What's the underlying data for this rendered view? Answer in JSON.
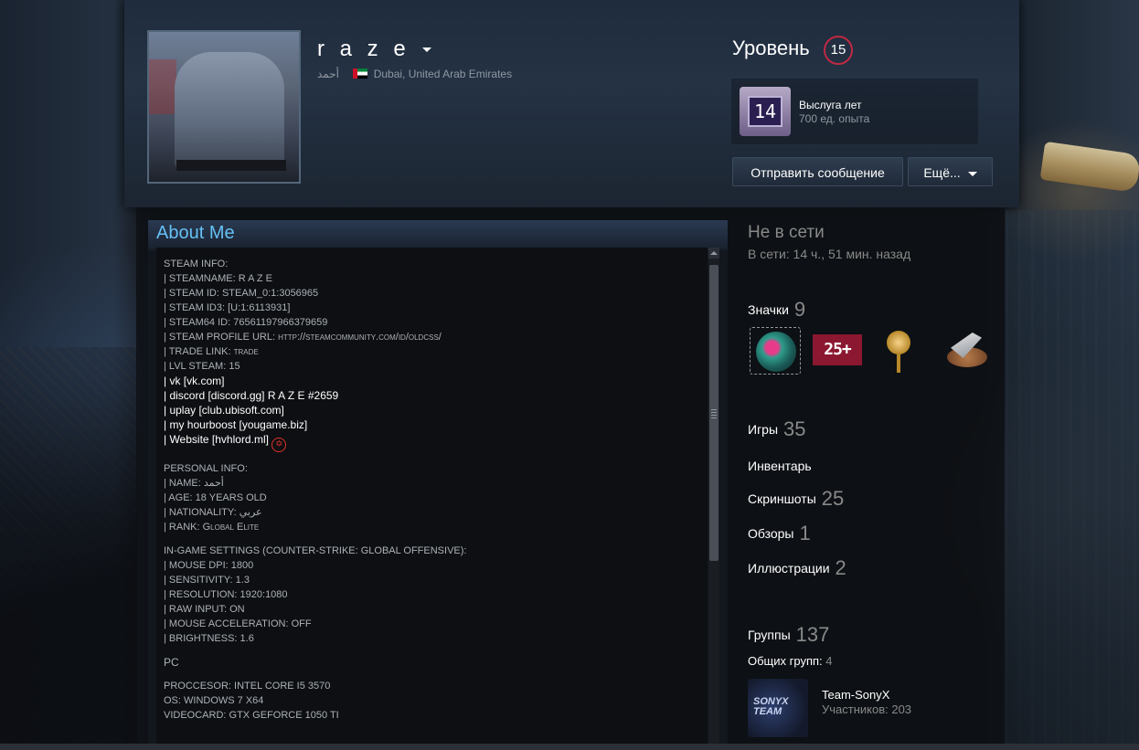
{
  "profile": {
    "persona_name": "r a z e",
    "real_name": "أحمد",
    "location": "Dubai, United Arab Emirates",
    "flag_colors": [
      "#00843d",
      "#ffffff",
      "#000000",
      "#ce1126"
    ]
  },
  "level": {
    "label": "Уровень",
    "value": "15"
  },
  "favorite_badge": {
    "icon_text": "14",
    "name": "Выслуга лет",
    "xp": "700 ед. опыта"
  },
  "actions": {
    "send_message": "Отправить сообщение",
    "more": "Ещё..."
  },
  "about": {
    "title": "About Me",
    "lines": [
      "STEAM INFO:",
      "| STEAMNAME: R A Z E",
      "| STEAM ID: STEAM_0:1:3056965",
      "| STEAM ID3: [U:1:6113931]",
      "| STEAM64 ID: 76561197966379659",
      "| STEAM PROFILE URL: http://steamcommunity.com/id/oldcss/",
      "| TRADE LINK: trade",
      "| LVL STEAM: 15",
      "| vk [vk.com]",
      "| discord [discord.gg] R A Z E #2659",
      "| uplay [club.ubisoft.com]",
      "| my hourboost [yougame.biz]",
      "| Website [hvhlord.ml]",
      "PERSONAL INFO:",
      "| NAME: أحمد",
      "| AGE: 18 YEARS OLD",
      "| NATIONALITY: عربي",
      "| RANK: Global Elite",
      "IN-GAME SETTINGS (COUNTER-STRIKE: GLOBAL OFFENSIVE):",
      "| MOUSE DPI: 1800",
      "| SENSITIVITY: 1.3",
      "| RESOLUTION: 1920:1080",
      "| RAW INPUT: ON",
      "| MOUSE ACCELERATION: OFF",
      "| BRIGHTNESS: 1.6",
      "PC",
      "PROCCESOR: INTEL CORE I5 3570",
      "OS: WINDOWS 7 X64",
      "VIDEOCARD: GTX GEFORCE 1050 TI"
    ]
  },
  "status": {
    "title": "Не в сети",
    "last_online": "В сети: 14 ч., 51 мин. назад"
  },
  "stats": {
    "badges_label": "Значки",
    "badges_count": "9",
    "badge_2_text": "25+",
    "games_label": "Игры",
    "games_count": "35",
    "inventory_label": "Инвентарь",
    "screenshots_label": "Скриншоты",
    "screenshots_count": "25",
    "reviews_label": "Обзоры",
    "reviews_count": "1",
    "artwork_label": "Иллюстрации",
    "artwork_count": "2",
    "groups_label": "Группы",
    "groups_count": "137",
    "shared_groups_label": "Общих групп:",
    "shared_groups_count": "4"
  },
  "group": {
    "avatar_text": "SONYX TEAM",
    "name": "Team-SonyX",
    "members": "Участников: 203"
  }
}
